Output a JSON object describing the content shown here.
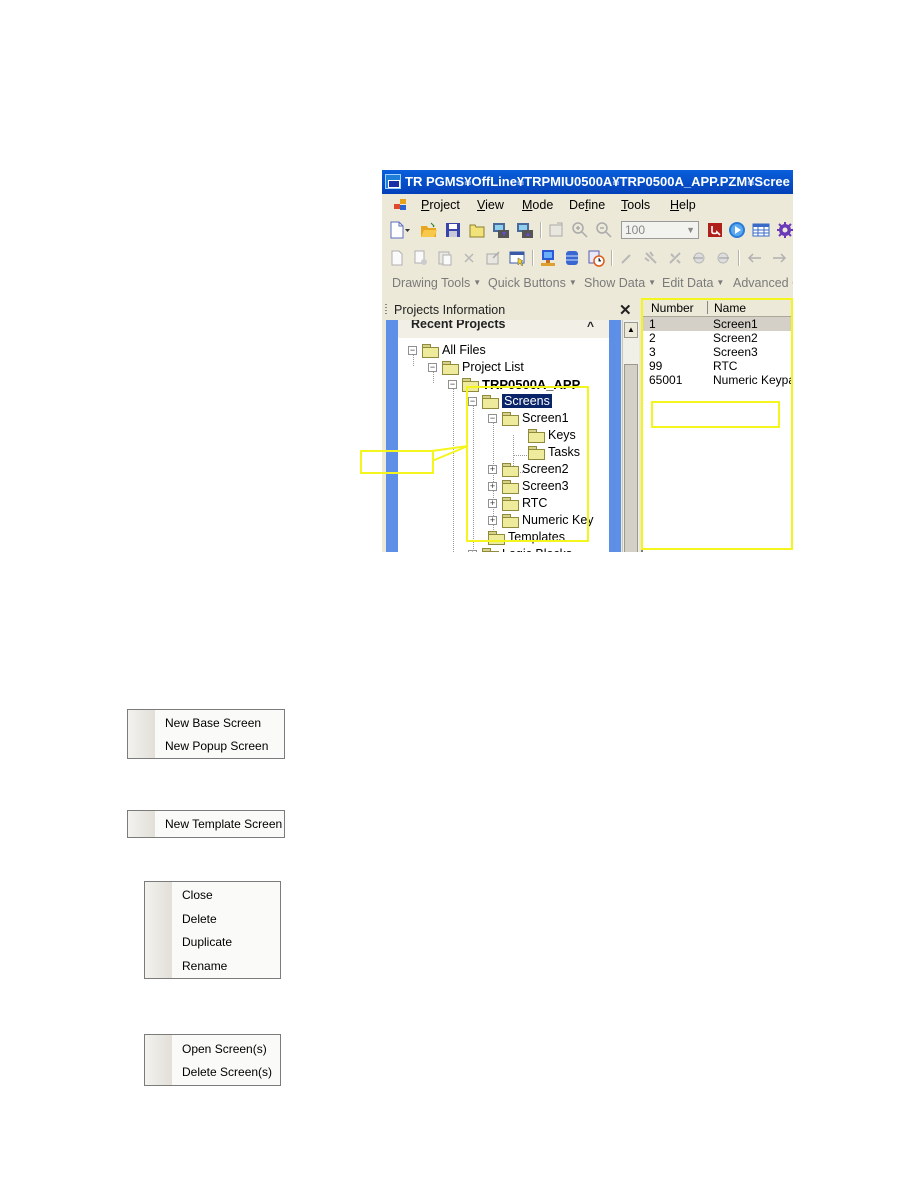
{
  "window": {
    "title": "TR PGMS¥OffLine¥TRPMIU0500A¥TRP0500A_APP.PZM¥Scree"
  },
  "menubar": {
    "items": [
      {
        "label": "Project",
        "accel": "P"
      },
      {
        "label": "View",
        "accel": "V"
      },
      {
        "label": "Mode",
        "accel": "M"
      },
      {
        "label": "Define",
        "accel": "f"
      },
      {
        "label": "Tools",
        "accel": "T"
      },
      {
        "label": "Help",
        "accel": "H"
      }
    ]
  },
  "toolbar1": {
    "icons": [
      "new-file-icon",
      "open-folder-icon",
      "save-icon",
      "folder-icon",
      "download-icon",
      "upload-icon",
      "properties-icon",
      "zoom-in-icon",
      "zoom-out-icon",
      "record-icon",
      "run-icon",
      "table-icon",
      "settings-gear-icon"
    ],
    "zoom_value": "100"
  },
  "toolbar2": {
    "icons": [
      "new-screen-icon",
      "copy-screen-icon",
      "paste-icon",
      "delete-x-icon",
      "edit-icon",
      "window-select-icon",
      "network-icon",
      "database-icon",
      "scheduler-clock-icon",
      "wand-icon",
      "tool-a-icon",
      "tool-b-icon",
      "tool-c-icon",
      "tool-d-icon",
      "back-arrow-icon",
      "forward-arrow-icon"
    ]
  },
  "toolbar3": {
    "groups": [
      "Drawing Tools",
      "Quick Buttons",
      "Show Data",
      "Edit Data",
      "Advanced C"
    ]
  },
  "projects_panel": {
    "title": "Projects Information",
    "section": "Recent Projects",
    "tree": [
      {
        "label": "All Files",
        "expander": "−"
      },
      {
        "label": "Project List",
        "expander": "−"
      },
      {
        "label": "TRP0500A_APP",
        "expander": "−"
      },
      {
        "label": "Screens",
        "expander": "−",
        "selected": true
      },
      {
        "label": "Screen1",
        "expander": "−"
      },
      {
        "label": "Keys",
        "expander": ""
      },
      {
        "label": "Tasks",
        "expander": ""
      },
      {
        "label": "Screen2",
        "expander": "+"
      },
      {
        "label": "Screen3",
        "expander": "+"
      },
      {
        "label": "RTC",
        "expander": "+"
      },
      {
        "label": "Numeric Key",
        "expander": "+"
      },
      {
        "label": "Templates",
        "expander": ""
      },
      {
        "label": "Logic Blocks",
        "expander": "+"
      }
    ]
  },
  "screen_list": {
    "columns": [
      "Number",
      "Name"
    ],
    "rows": [
      {
        "number": "1",
        "name": "Screen1",
        "selected": true
      },
      {
        "number": "2",
        "name": "Screen2"
      },
      {
        "number": "3",
        "name": "Screen3"
      },
      {
        "number": "99",
        "name": "RTC"
      },
      {
        "number": "65001",
        "name": "Numeric Keypa"
      }
    ]
  },
  "annotation_color": "#f5f51e",
  "context_menus": {
    "screens": [
      "New Base Screen",
      "New Popup Screen"
    ],
    "templates": [
      "New Template Screen"
    ],
    "screen_item": [
      "Close",
      "Delete",
      "Duplicate",
      "Rename"
    ],
    "screen_list": [
      "Open Screen(s)",
      "Delete Screen(s)"
    ]
  }
}
